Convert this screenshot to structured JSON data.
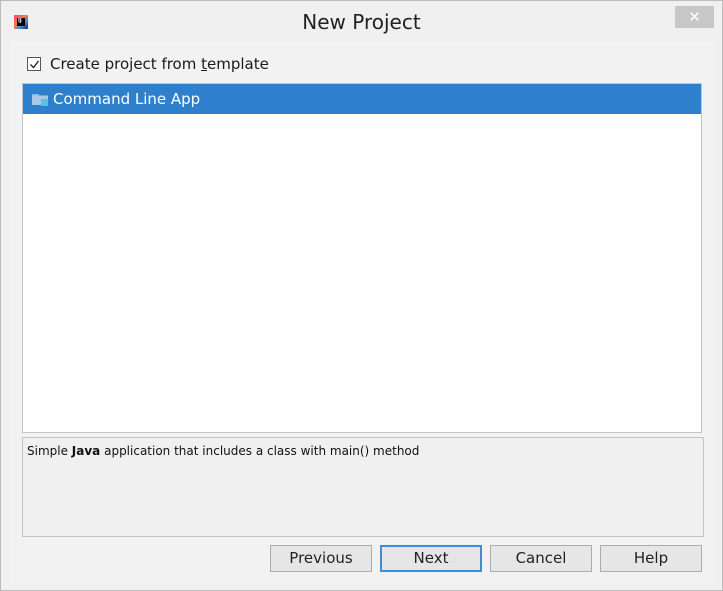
{
  "window": {
    "title": "New Project",
    "close_symbol": "✕"
  },
  "template_option": {
    "checked": true,
    "label_before": "Create project from ",
    "label_underlined": "t",
    "label_after": "emplate"
  },
  "templates": [
    {
      "label": "Command Line App",
      "selected": true,
      "icon": "folder-icon"
    }
  ],
  "description": {
    "prefix": "Simple ",
    "bold": "Java",
    "suffix": " application that includes a class with main() method"
  },
  "buttons": {
    "previous": "Previous",
    "next": "Next",
    "cancel": "Cancel",
    "help": "Help"
  },
  "colors": {
    "selection": "#2f80cc",
    "default_button_border": "#3c8ed6"
  }
}
